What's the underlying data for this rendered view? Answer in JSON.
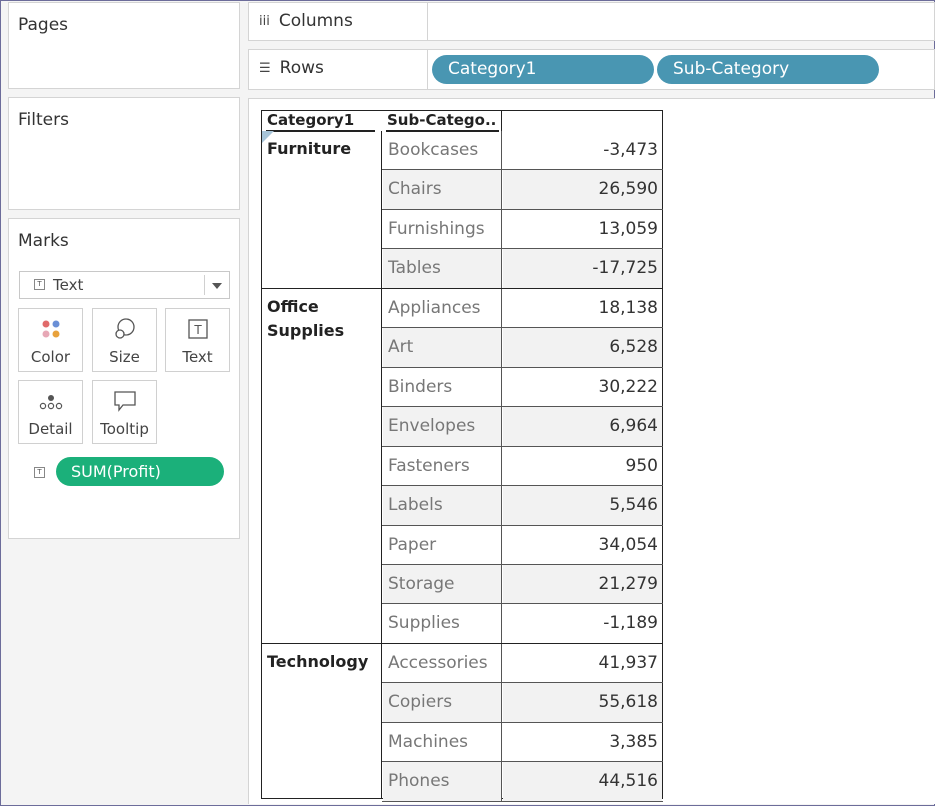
{
  "panels": {
    "pages": {
      "title": "Pages"
    },
    "filters": {
      "title": "Filters"
    },
    "marks": {
      "title": "Marks",
      "mark_type": "Text",
      "buttons": [
        {
          "label": "Color",
          "icon": "color-icon"
        },
        {
          "label": "Size",
          "icon": "size-icon"
        },
        {
          "label": "Text",
          "icon": "text-icon"
        },
        {
          "label": "Detail",
          "icon": "detail-icon"
        },
        {
          "label": "Tooltip",
          "icon": "tooltip-icon"
        }
      ],
      "text_field": "SUM(Profit)"
    }
  },
  "shelves": {
    "columns": {
      "label": "Columns",
      "icon": "iii"
    },
    "rows": {
      "label": "Rows",
      "icon": "☰",
      "pills": [
        "Category1",
        "Sub-Category"
      ]
    }
  },
  "colors": {
    "dimension_pill": "#4996b2",
    "measure_pill": "#1bb07a"
  },
  "table": {
    "headers": {
      "category": "Category1",
      "sub_category": "Sub-Catego.."
    },
    "groups": [
      {
        "category": "Furniture",
        "rows": [
          {
            "sub": "Bookcases",
            "value": "-3,473"
          },
          {
            "sub": "Chairs",
            "value": "26,590"
          },
          {
            "sub": "Furnishings",
            "value": "13,059"
          },
          {
            "sub": "Tables",
            "value": "-17,725"
          }
        ]
      },
      {
        "category": "Office Supplies",
        "rows": [
          {
            "sub": "Appliances",
            "value": "18,138"
          },
          {
            "sub": "Art",
            "value": "6,528"
          },
          {
            "sub": "Binders",
            "value": "30,222"
          },
          {
            "sub": "Envelopes",
            "value": "6,964"
          },
          {
            "sub": "Fasteners",
            "value": "950"
          },
          {
            "sub": "Labels",
            "value": "5,546"
          },
          {
            "sub": "Paper",
            "value": "34,054"
          },
          {
            "sub": "Storage",
            "value": "21,279"
          },
          {
            "sub": "Supplies",
            "value": "-1,189"
          }
        ]
      },
      {
        "category": "Technology",
        "rows": [
          {
            "sub": "Accessories",
            "value": "41,937"
          },
          {
            "sub": "Copiers",
            "value": "55,618"
          },
          {
            "sub": "Machines",
            "value": "3,385"
          },
          {
            "sub": "Phones",
            "value": "44,516"
          }
        ]
      }
    ]
  }
}
